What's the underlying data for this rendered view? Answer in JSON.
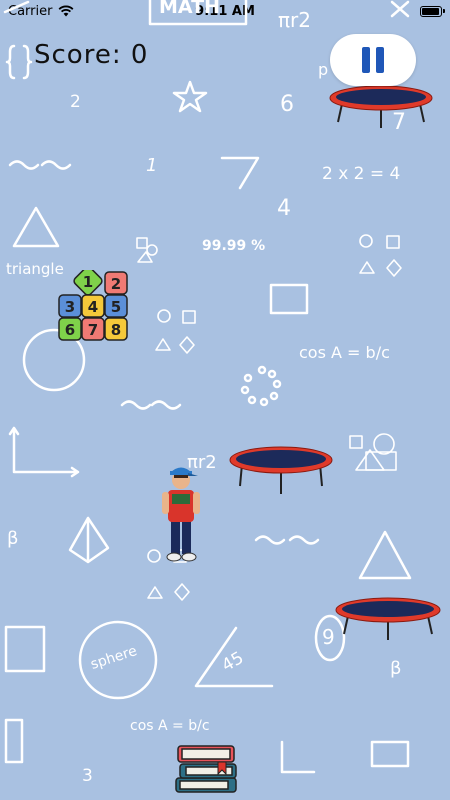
{
  "status_bar": {
    "carrier": "Carrier",
    "time": "9:11 AM"
  },
  "hud": {
    "score_label": "Score:",
    "score_value": "0"
  },
  "background_text": {
    "math_top": "MATH",
    "pi_r2_top": "πr2",
    "p_top": "p",
    "two": "2",
    "six": "6",
    "seven": "7",
    "one": "1",
    "two_times_two": "2 x 2 = 4",
    "four": "4",
    "percent": "99.99 %",
    "triangle": "triangle",
    "cos_mid": "cos A = b/c",
    "pi_r2_mid": "πr2",
    "beta_left": "β",
    "nine": "9",
    "beta_right": "β",
    "sphere": "sphere",
    "forty_five": "45",
    "cos_bottom": "cos A = b/c",
    "three": "3"
  },
  "number_blocks": [
    "1",
    "2",
    "3",
    "4",
    "5",
    "6",
    "7",
    "8"
  ],
  "colors": {
    "background": "#a9c1e1",
    "trampoline_rim": "#e03a2a",
    "trampoline_bed": "#1c2a5a",
    "pause_icon": "#1f57b8",
    "block_green": "#7fd24a",
    "block_red": "#f07a74",
    "block_blue": "#5b8fd8",
    "block_yellow": "#f5c93a"
  }
}
